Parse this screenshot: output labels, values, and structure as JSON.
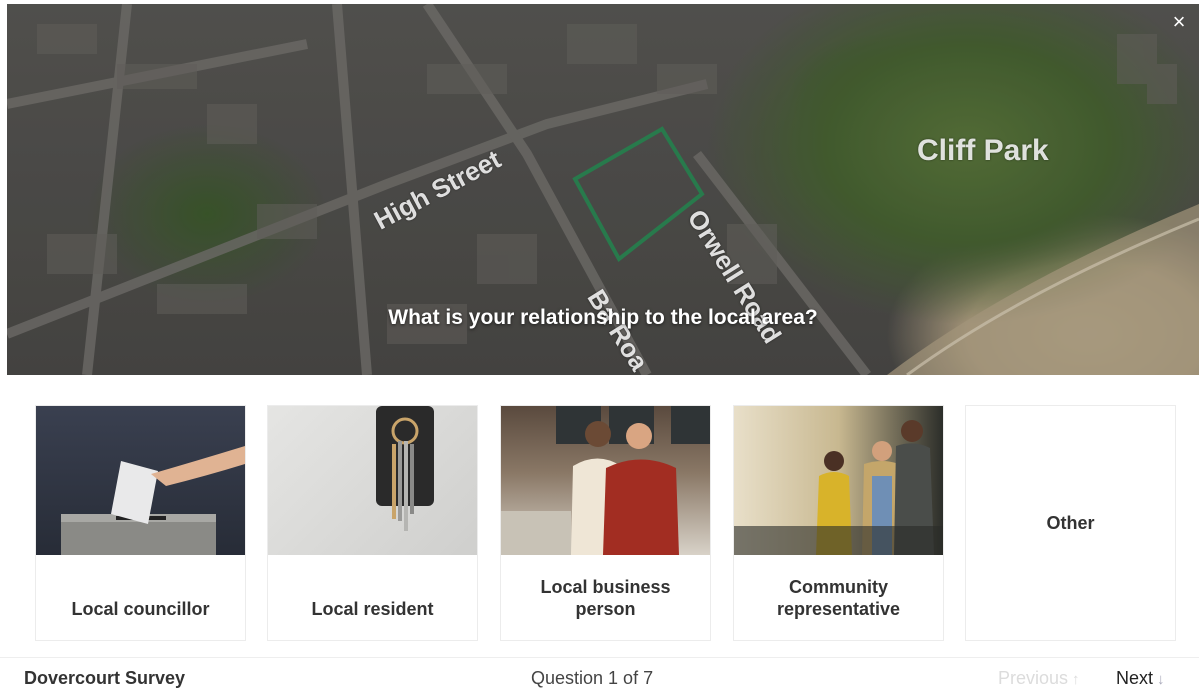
{
  "hero": {
    "question": "What is your relationship to the local area?",
    "map_labels": {
      "cliff_park": "Cliff Park",
      "high_street": "High Street",
      "orwell_road": "Orwell Road",
      "bath_road": "Ba  Roa"
    },
    "site_outline_color": "#2e8b57"
  },
  "close_label": "×",
  "options": [
    {
      "label": "Local councillor",
      "image": "ballot-box-photo"
    },
    {
      "label": "Local resident",
      "image": "house-keys-photo"
    },
    {
      "label": "Local business person",
      "image": "cafe-owners-photo"
    },
    {
      "label": "Community representative",
      "image": "people-talking-photo"
    },
    {
      "label": "Other",
      "image": null
    }
  ],
  "footer": {
    "survey_title": "Dovercourt Survey",
    "progress": "Question 1 of 7",
    "previous_label": "Previous",
    "previous_arrow": "↑",
    "next_label": "Next",
    "next_arrow": "↓"
  }
}
